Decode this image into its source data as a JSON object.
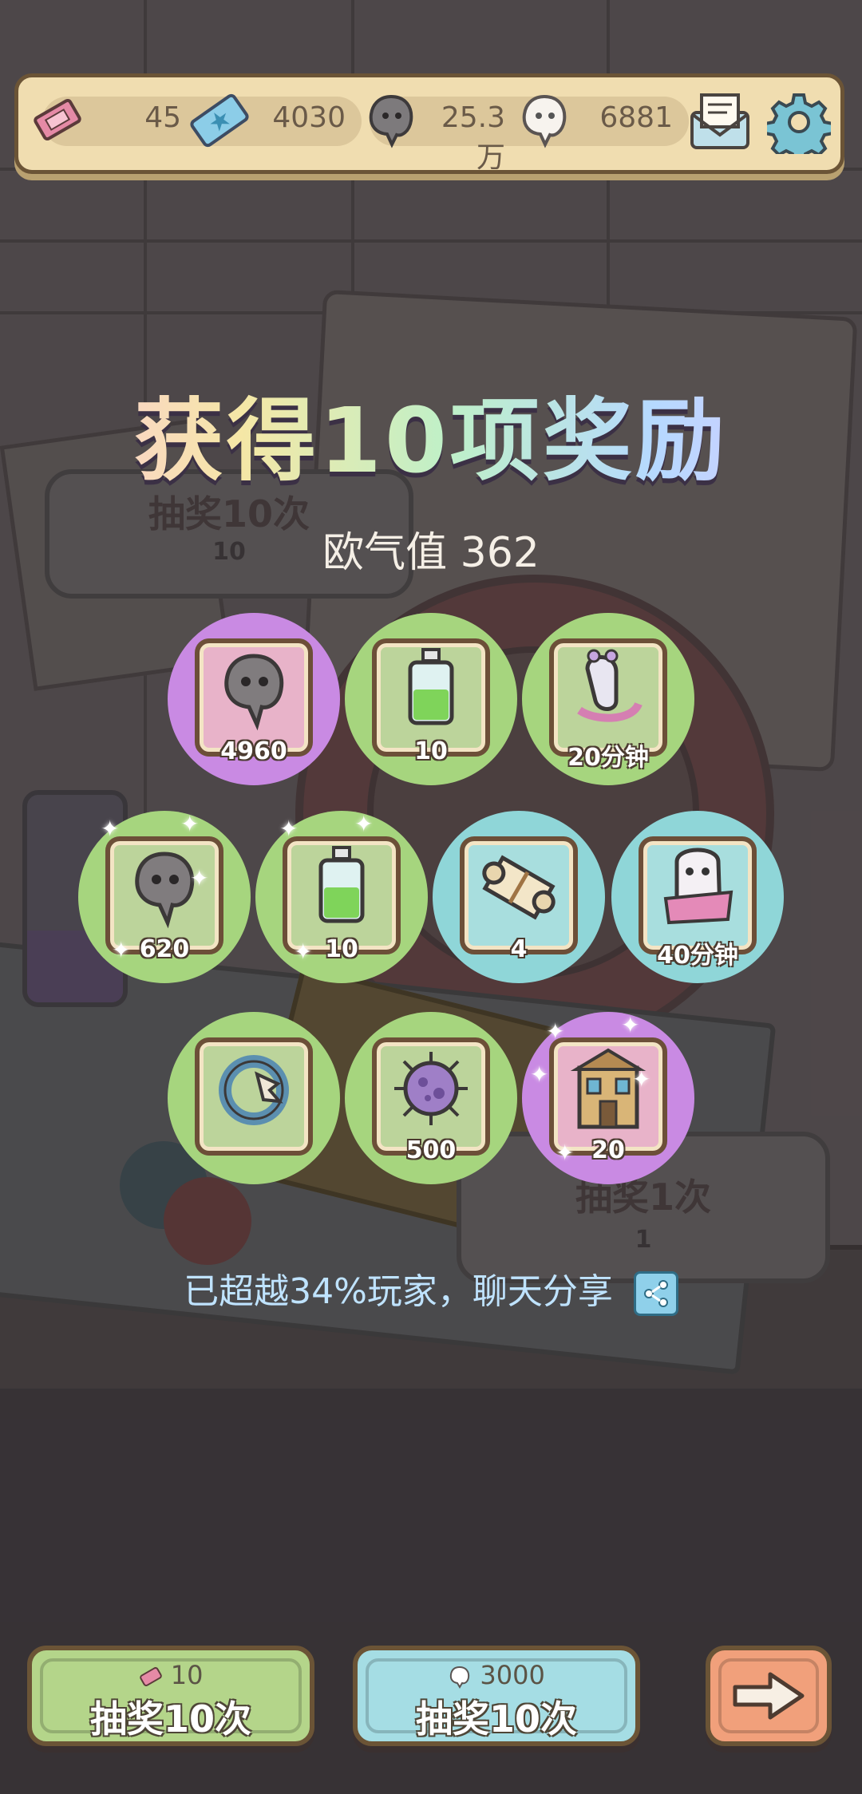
{
  "resources": {
    "tickets": "45",
    "blue_tickets": "4030",
    "dark_ghosts": "25.3万",
    "light_ghosts": "6881"
  },
  "background_buttons": {
    "draw10_label": "抽奖10次",
    "draw10_cost": "10",
    "draw1_label": "抽奖1次",
    "draw1_cost": "1"
  },
  "result": {
    "title": "获得10项奖励",
    "luck_text": "欧气值 362",
    "share_text": "已超越34%玩家，聊天分享"
  },
  "rewards": [
    {
      "name": "dark-ghost",
      "qty": "4960",
      "rarity": "purple"
    },
    {
      "name": "green-potion",
      "qty": "10",
      "rarity": "green"
    },
    {
      "name": "snail-time",
      "qty": "20分钟",
      "rarity": "green"
    },
    {
      "name": "dark-ghost",
      "qty": "620",
      "rarity": "green"
    },
    {
      "name": "green-potion",
      "qty": "10",
      "rarity": "green"
    },
    {
      "name": "scroll",
      "qty": "4",
      "rarity": "blue"
    },
    {
      "name": "ghost-time",
      "qty": "40分钟",
      "rarity": "blue"
    },
    {
      "name": "claw-ring",
      "qty": "",
      "rarity": "green"
    },
    {
      "name": "purple-virus",
      "qty": "500",
      "rarity": "green"
    },
    {
      "name": "building",
      "qty": "20",
      "rarity": "purple"
    }
  ],
  "buttons": {
    "draw10_ticket_cost": "10",
    "draw10_ticket_label": "抽奖10次",
    "draw10_ghost_cost": "3000",
    "draw10_ghost_label": "抽奖10次"
  },
  "colors": {
    "green_circle": "#a6d57e",
    "blue_circle": "#8fd6d8",
    "purple_circle": "#c98ae3",
    "topbar": "#f0ddb0",
    "btn_green": "#b4d58a",
    "btn_blue": "#a5dde4",
    "btn_orange": "#f1a07b"
  }
}
